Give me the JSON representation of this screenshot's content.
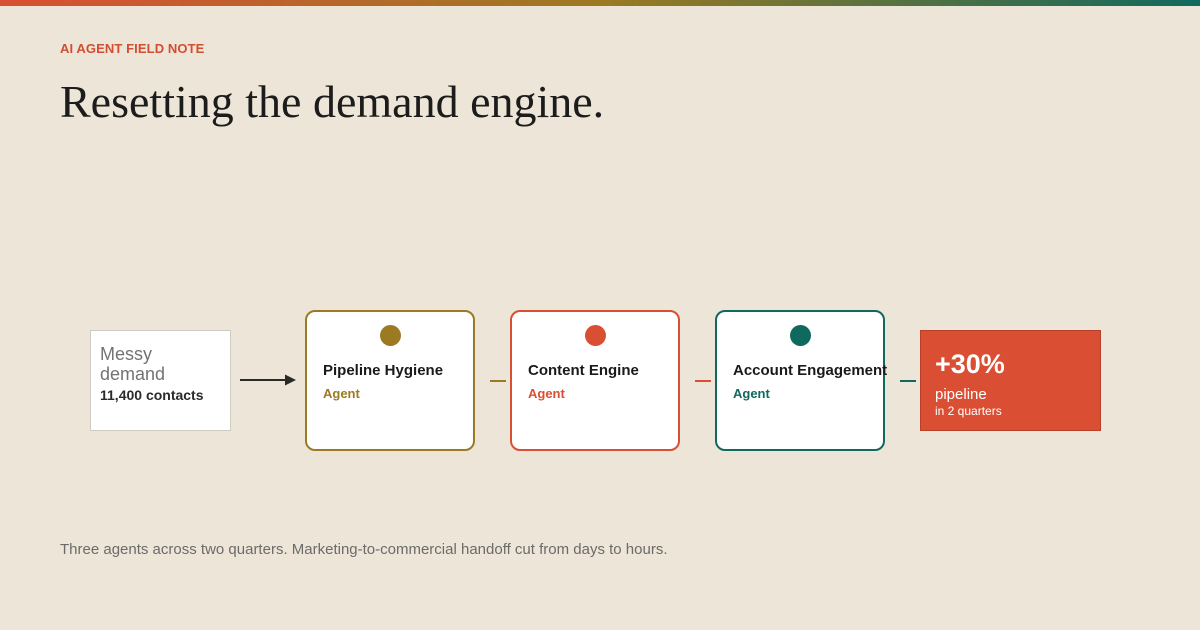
{
  "header": {
    "eyebrow": "AI AGENT FIELD NOTE",
    "title": "Resetting the demand engine."
  },
  "input": {
    "label": "Messy demand",
    "count": "11,400 contacts"
  },
  "agents": [
    {
      "name": "Pipeline Hygiene",
      "role": "Agent",
      "color": "#9c7a22"
    },
    {
      "name": "Content Engine",
      "role": "Agent",
      "color": "#d94f33"
    },
    {
      "name": "Account Engagement",
      "role": "Agent",
      "color": "#10695f"
    }
  ],
  "result": {
    "value": "+30%",
    "label": "pipeline",
    "sublabel": "in 2 quarters",
    "color": "#da4f33"
  },
  "footer": {
    "note": "Three agents across two quarters. Marketing-to-commercial handoff cut from days to hours."
  },
  "colors": {
    "background": "#ede5d7",
    "accent_red": "#d94f33",
    "accent_gold": "#9c7a22",
    "accent_teal": "#10695f"
  },
  "icons": {
    "flow_arrow": "arrow-right-icon",
    "agent_marker": "circle-dot-icon"
  }
}
